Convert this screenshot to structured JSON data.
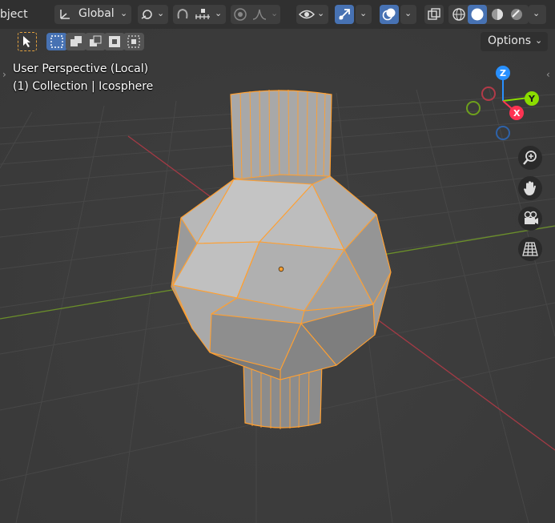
{
  "header": {
    "mode_label_fragment": "bject",
    "transform_orientation": "Global",
    "chevron": "⌄"
  },
  "options": {
    "label": "Options",
    "chevron": "⌄"
  },
  "viewport": {
    "view_name": "User Perspective (Local)",
    "object_info": "(1) Collection | Icosphere",
    "object_name": "Icosphere",
    "collection_name": "Collection"
  },
  "gizmo": {
    "x_label": "X",
    "y_label": "Y",
    "z_label": "Z"
  },
  "nav_buttons": [
    "zoom-icon",
    "hand-pan-icon",
    "camera-view-icon",
    "ortho-grid-icon"
  ],
  "colors": {
    "accent_blue": "#4772b3",
    "selection_orange": "#ffa032",
    "axis_x": "#ff3352",
    "axis_y": "#8bdc00",
    "axis_z": "#2890ff",
    "background": "#3d3d3d"
  }
}
